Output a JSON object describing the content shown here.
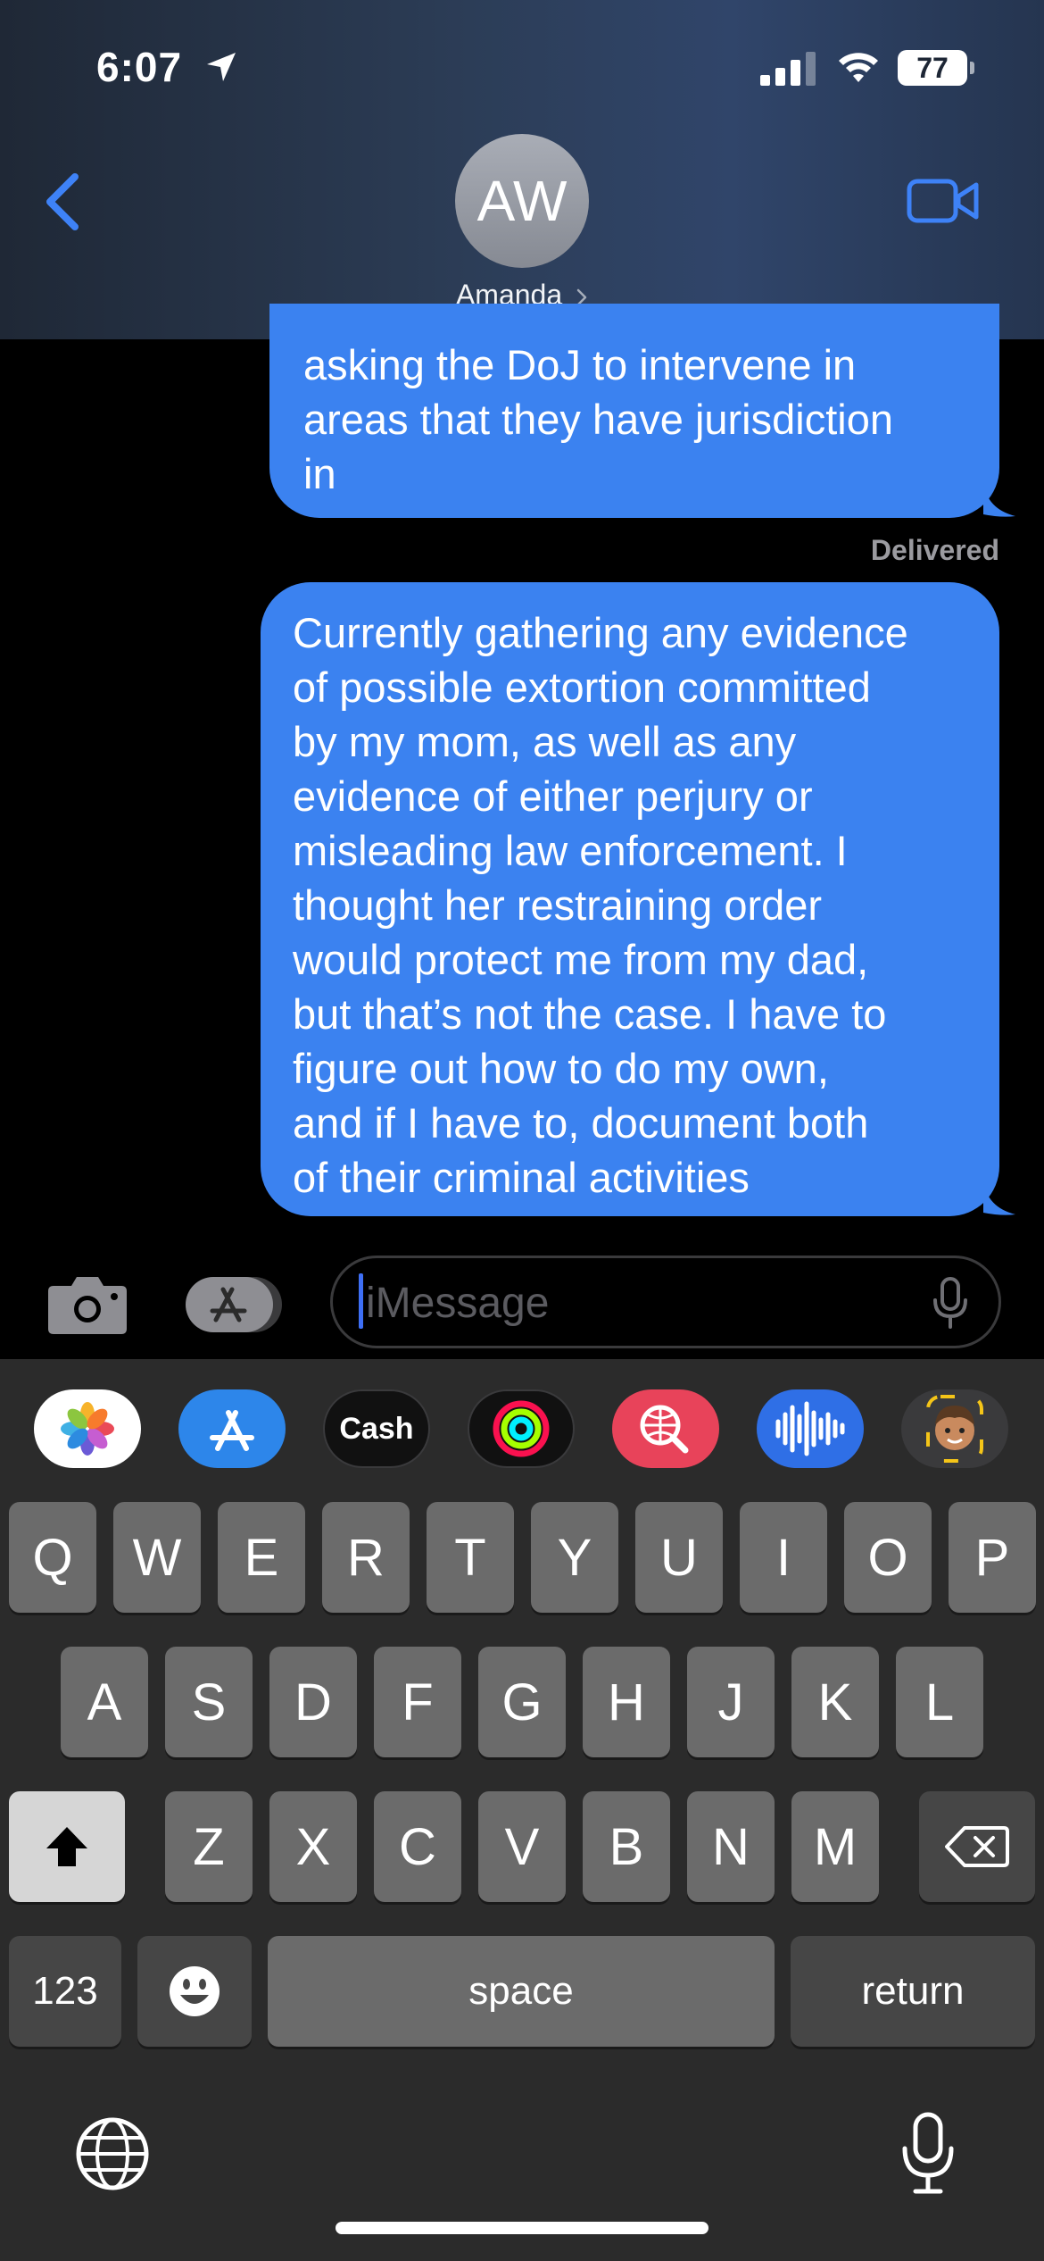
{
  "status_bar": {
    "time": "6:07",
    "battery": "77",
    "icons": [
      "location-arrow-icon",
      "cellular-signal-icon",
      "wifi-icon",
      "battery-icon"
    ]
  },
  "header": {
    "avatar_initials": "AW",
    "contact_name": "Amanda",
    "icons": [
      "chevron-left-icon",
      "chevron-right-icon",
      "video-camera-icon"
    ]
  },
  "colors": {
    "bubble_blue": "#3b82f0",
    "accent_blue": "#3e6ff5",
    "keyboard_bg": "#2b2b2b",
    "key_bg": "#6b6b6b"
  },
  "messages": [
    {
      "sender": "me",
      "lines": [
        "asking the DoJ to intervene in",
        "areas that they have jurisdiction",
        "in"
      ]
    },
    {
      "sender": "me",
      "lines": [
        "Currently gathering any evidence",
        "of possible extortion committed",
        "by my mom, as well as any",
        "evidence of either perjury or",
        "misleading law enforcement. I",
        "thought her restraining order",
        "would protect me from my dad,",
        "but that’s not the case. I have to",
        "figure out how to do my own,",
        "and if I have to, document both",
        "of their criminal activities"
      ]
    }
  ],
  "delivered_label": "Delivered",
  "composer": {
    "placeholder": "iMessage",
    "icons": [
      "camera-icon",
      "app-store-icon",
      "microphone-icon"
    ]
  },
  "app_strip": [
    {
      "name": "photos",
      "label": ""
    },
    {
      "name": "app-store",
      "label": ""
    },
    {
      "name": "apple-cash",
      "label": "Cash"
    },
    {
      "name": "activity",
      "label": ""
    },
    {
      "name": "image-search",
      "label": ""
    },
    {
      "name": "audio-message",
      "label": ""
    },
    {
      "name": "memoji",
      "label": ""
    }
  ],
  "keyboard": {
    "row1": [
      "Q",
      "W",
      "E",
      "R",
      "T",
      "Y",
      "U",
      "I",
      "O",
      "P"
    ],
    "row2": [
      "A",
      "S",
      "D",
      "F",
      "G",
      "H",
      "J",
      "K",
      "L"
    ],
    "row3": [
      "Z",
      "X",
      "C",
      "V",
      "B",
      "N",
      "M"
    ],
    "numbers_key": "123",
    "space_key": "space",
    "return_key": "return",
    "icons": [
      "shift-icon",
      "delete-icon",
      "emoji-icon",
      "globe-icon",
      "dictation-microphone-icon"
    ]
  }
}
